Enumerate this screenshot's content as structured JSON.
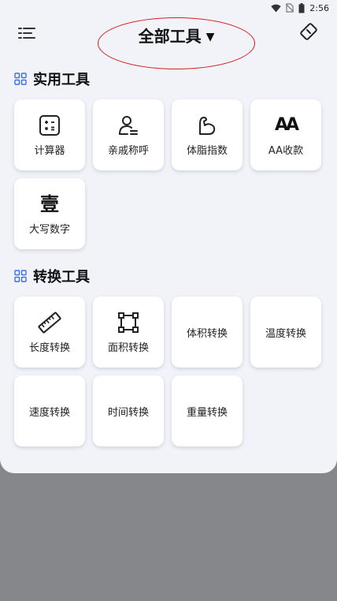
{
  "status": {
    "time": "2:56"
  },
  "header": {
    "title": "全部工具",
    "caret": "▼"
  },
  "sections": [
    {
      "title": "实用工具",
      "items": [
        {
          "label": "计算器",
          "icon": "calculator-icon"
        },
        {
          "label": "亲戚称呼",
          "icon": "person-list-icon"
        },
        {
          "label": "体脂指数",
          "icon": "muscle-arm-icon"
        },
        {
          "label": "AA收款",
          "icon": "aa-icon",
          "glyph": "AA"
        },
        {
          "label": "大写数字",
          "icon": "chinese-numeral-icon",
          "glyph": "壹"
        }
      ]
    },
    {
      "title": "转换工具",
      "items": [
        {
          "label": "长度转换",
          "icon": "ruler-icon"
        },
        {
          "label": "面积转换",
          "icon": "area-square-icon"
        },
        {
          "label": "体积转换"
        },
        {
          "label": "温度转换"
        },
        {
          "label": "速度转换"
        },
        {
          "label": "时间转换"
        },
        {
          "label": "重量转换"
        }
      ]
    }
  ],
  "colors": {
    "annotation": "#d81e1e",
    "accent": "#3f6ee8",
    "sheet": "#f1f3f8",
    "backdrop": "#86878b"
  }
}
